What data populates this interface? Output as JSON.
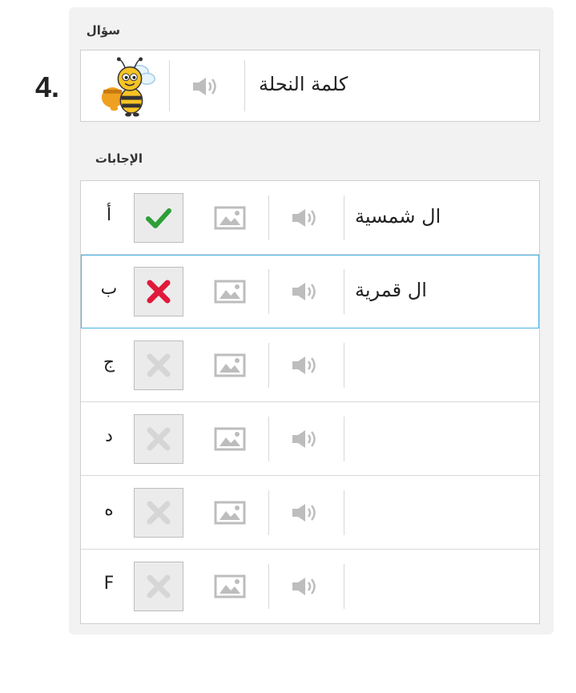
{
  "question": {
    "number": "4.",
    "section_label": "سؤال",
    "text": "كلمة النحلة",
    "image": "bee-image",
    "audio_icon": "speaker-icon"
  },
  "answers_label": "الإجابات",
  "answers": [
    {
      "letter": "أ",
      "text": "ال شمسية",
      "state": "correct"
    },
    {
      "letter": "ب",
      "text": "ال قمرية",
      "state": "incorrect"
    },
    {
      "letter": "ج",
      "text": "",
      "state": "empty"
    },
    {
      "letter": "د",
      "text": "",
      "state": "empty"
    },
    {
      "letter": "ه",
      "text": "",
      "state": "empty"
    },
    {
      "letter": "F",
      "text": "",
      "state": "empty"
    }
  ],
  "colors": {
    "correct": "#2e9e3a",
    "incorrect": "#e0193a",
    "empty": "#d6d6d6",
    "selected_border": "#4bb3e4",
    "icon": "#bdbdbd"
  }
}
